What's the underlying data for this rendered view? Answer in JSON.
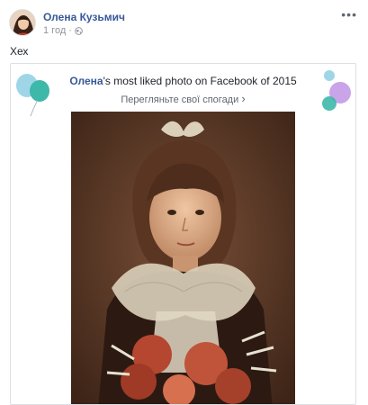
{
  "post": {
    "author": "Олена Кузьмич",
    "timestamp": "1 год",
    "separator": "·",
    "more_label": "•••",
    "text": "Хех"
  },
  "card": {
    "title_name": "Олена",
    "title_rest": "'s most liked photo on Facebook of 2015",
    "subtitle": "Перегляньте свої спогади",
    "chevron": "›"
  },
  "icons": {
    "avatar": "avatar",
    "privacy": "globe-icon",
    "more": "more-options-icon",
    "balloons_left": "balloons-icon",
    "balloons_right": "bubbles-icon"
  },
  "colors": {
    "link": "#385898",
    "muted": "#90949c",
    "balloon_teal": "#3eb8a8",
    "balloon_light_blue": "#9fd6e7",
    "balloon_purple": "#c9a4e8"
  }
}
